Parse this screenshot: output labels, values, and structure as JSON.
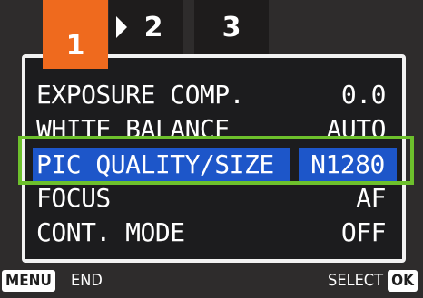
{
  "tabs": [
    {
      "label": "1",
      "active": true
    },
    {
      "label": "2",
      "active": false
    },
    {
      "label": "3",
      "active": false
    }
  ],
  "menu": {
    "items": [
      {
        "label": "EXPOSURE COMP.",
        "value": "0.0"
      },
      {
        "label": "WHITE BALANCE",
        "value": "AUTO"
      },
      {
        "label": "PIC QUALITY/SIZE",
        "value": "N1280",
        "selected": true
      },
      {
        "label": "FOCUS",
        "value": "AF"
      },
      {
        "label": "CONT. MODE",
        "value": "OFF"
      }
    ]
  },
  "footer": {
    "menu_key": "MENU",
    "menu_action": "END",
    "select_action": "SELECT",
    "ok_key": "OK"
  },
  "colors": {
    "active_tab": "#ef6a1e",
    "selection": "#1d56c9",
    "highlight_border": "#6dc02c",
    "panel_bg": "#1c1c1e"
  },
  "icons": [
    "chevron-right-icon"
  ]
}
